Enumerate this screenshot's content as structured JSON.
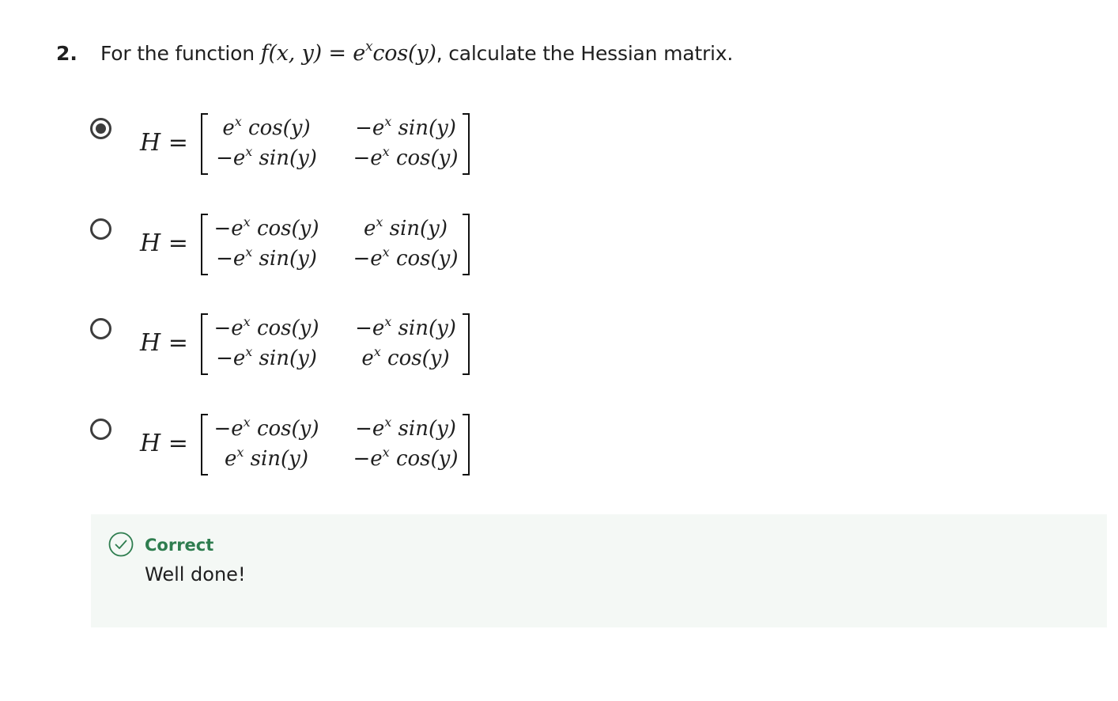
{
  "question": {
    "number": "2.",
    "text_before": "For the function ",
    "function_lhs": "f(x, y)",
    "equals": "=",
    "function_rhs_base": "e",
    "function_rhs_exp": "x",
    "function_rhs_rest": "cos(y)",
    "text_after": ", calculate the Hessian matrix."
  },
  "options": [
    {
      "selected": true,
      "label": "H =",
      "cells": [
        "e^x cos(y)",
        "−e^x sin(y)",
        "−e^x sin(y)",
        "−e^x cos(y)"
      ],
      "cell_parts": [
        {
          "pre": "",
          "base": "e",
          "exp": "x",
          "fn": "cos(y)"
        },
        {
          "pre": "−",
          "base": "e",
          "exp": "x",
          "fn": "sin(y)"
        },
        {
          "pre": "−",
          "base": "e",
          "exp": "x",
          "fn": "sin(y)"
        },
        {
          "pre": "−",
          "base": "e",
          "exp": "x",
          "fn": "cos(y)"
        }
      ]
    },
    {
      "selected": false,
      "label": "H =",
      "cells": [
        "−e^x cos(y)",
        "e^x sin(y)",
        "−e^x sin(y)",
        "−e^x cos(y)"
      ],
      "cell_parts": [
        {
          "pre": "−",
          "base": "e",
          "exp": "x",
          "fn": "cos(y)"
        },
        {
          "pre": "",
          "base": "e",
          "exp": "x",
          "fn": "sin(y)"
        },
        {
          "pre": "−",
          "base": "e",
          "exp": "x",
          "fn": "sin(y)"
        },
        {
          "pre": "−",
          "base": "e",
          "exp": "x",
          "fn": "cos(y)"
        }
      ]
    },
    {
      "selected": false,
      "label": "H =",
      "cells": [
        "−e^x cos(y)",
        "−e^x sin(y)",
        "−e^x sin(y)",
        "e^x cos(y)"
      ],
      "cell_parts": [
        {
          "pre": "−",
          "base": "e",
          "exp": "x",
          "fn": "cos(y)"
        },
        {
          "pre": "−",
          "base": "e",
          "exp": "x",
          "fn": "sin(y)"
        },
        {
          "pre": "−",
          "base": "e",
          "exp": "x",
          "fn": "sin(y)"
        },
        {
          "pre": "",
          "base": "e",
          "exp": "x",
          "fn": "cos(y)"
        }
      ]
    },
    {
      "selected": false,
      "label": "H =",
      "cells": [
        "−e^x cos(y)",
        "−e^x sin(y)",
        "e^x sin(y)",
        "−e^x cos(y)"
      ],
      "cell_parts": [
        {
          "pre": "−",
          "base": "e",
          "exp": "x",
          "fn": "cos(y)"
        },
        {
          "pre": "−",
          "base": "e",
          "exp": "x",
          "fn": "sin(y)"
        },
        {
          "pre": "",
          "base": "e",
          "exp": "x",
          "fn": "sin(y)"
        },
        {
          "pre": "−",
          "base": "e",
          "exp": "x",
          "fn": "cos(y)"
        }
      ]
    }
  ],
  "feedback": {
    "icon": "check-circle-icon",
    "title": "Correct",
    "message": "Well done!",
    "accent_color": "#2e7d4f",
    "background_color": "#f4f8f5"
  }
}
